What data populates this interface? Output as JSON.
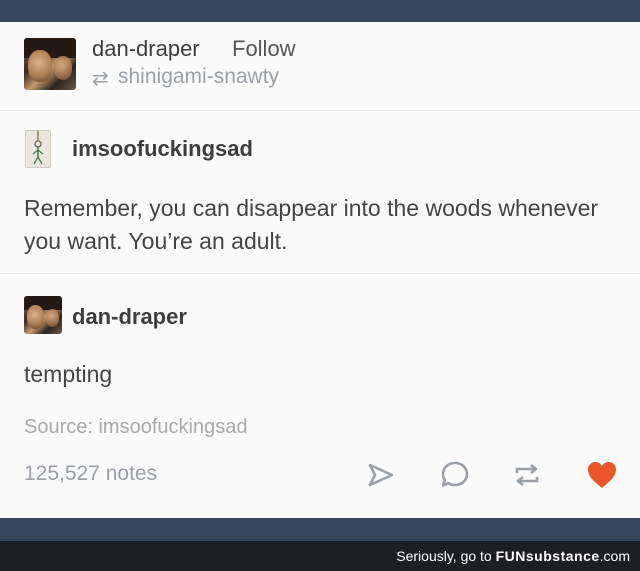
{
  "post": {
    "reblogger": "dan-draper",
    "follow_label": "Follow",
    "reblog_icon": "reblog-arrows-icon",
    "reblogged_from": "shinigami-snawty"
  },
  "original": {
    "author": "imsoofuckingsad",
    "text": "Remember, you can disappear into the woods whenever you want. You’re an adult."
  },
  "reply": {
    "author": "dan-draper",
    "text": "tempting"
  },
  "source": "Source: imsoofuckingsad",
  "notes": "125,527 notes",
  "actions": [
    "send-icon",
    "comment-icon",
    "reblog-icon",
    "heart-icon"
  ],
  "colors": {
    "heart": "#e8562a",
    "icons": "#9aa0a6",
    "dashboard": "#36465d"
  },
  "footer": {
    "prefix": "Seriously, go to ",
    "brand": "FUNsubstance",
    "suffix": ".com"
  }
}
